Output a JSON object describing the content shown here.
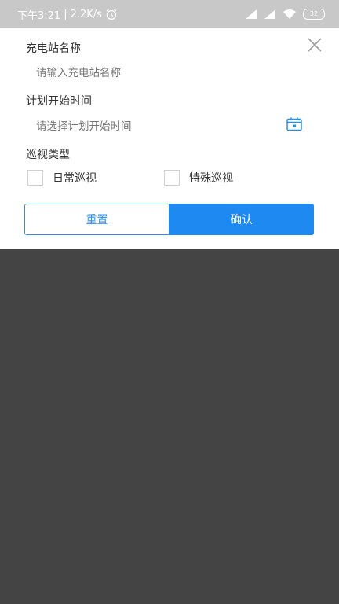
{
  "status_bar": {
    "time": "下午3:21",
    "speed": "2.2K/s",
    "battery": "32"
  },
  "form": {
    "station_name_label": "充电站名称",
    "station_name_placeholder": "请输入充电站名称",
    "start_time_label": "计划开始时间",
    "start_time_placeholder": "请选择计划开始时间",
    "inspection_type_label": "巡视类型",
    "options": [
      {
        "label": "日常巡视",
        "checked": false
      },
      {
        "label": "特殊巡视",
        "checked": false
      }
    ]
  },
  "buttons": {
    "reset": "重置",
    "confirm": "确认"
  },
  "colors": {
    "accent": "#1e89f0",
    "overlay": "#444444"
  },
  "icons": {
    "close": "close-icon",
    "calendar": "calendar-icon"
  }
}
